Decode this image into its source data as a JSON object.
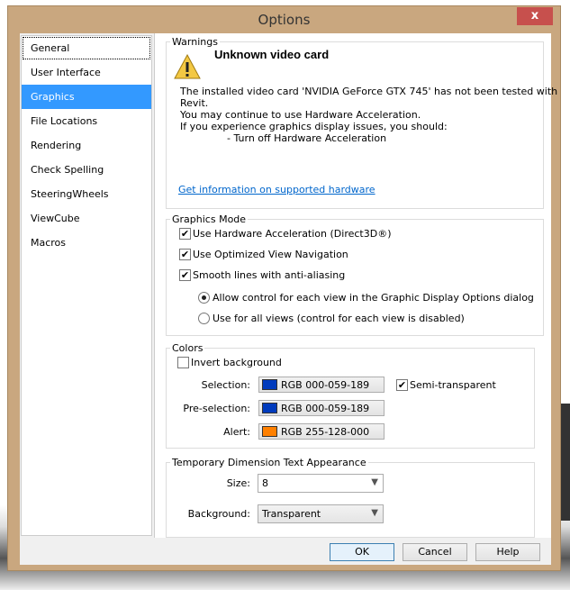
{
  "window": {
    "title": "Options",
    "close_label": "x"
  },
  "sidebar": {
    "items": [
      {
        "label": "General"
      },
      {
        "label": "User Interface"
      },
      {
        "label": "Graphics"
      },
      {
        "label": "File Locations"
      },
      {
        "label": "Rendering"
      },
      {
        "label": "Check Spelling"
      },
      {
        "label": "SteeringWheels"
      },
      {
        "label": "ViewCube"
      },
      {
        "label": "Macros"
      }
    ],
    "selected": "Graphics"
  },
  "warnings": {
    "legend": "Warnings",
    "heading": "Unknown video card",
    "lines": [
      "The installed video card 'NVIDIA GeForce GTX 745' has not been tested with",
      "Revit.",
      "You may continue to use Hardware Acceleration.",
      "If you experience graphics display issues, you should:",
      "- Turn off Hardware Acceleration"
    ],
    "link": "Get information on supported hardware"
  },
  "graphics_mode": {
    "legend": "Graphics Mode",
    "hw_accel": {
      "label": "Use Hardware Acceleration (Direct3D®)",
      "checked": true
    },
    "optimized_nav": {
      "label": "Use Optimized View Navigation",
      "checked": true
    },
    "smooth_lines": {
      "label": "Smooth lines with anti-aliasing",
      "checked": true
    },
    "radio_each": {
      "label": "Allow control for each view in the Graphic Display Options dialog",
      "selected": true
    },
    "radio_all": {
      "label": "Use for all views (control for each view is disabled)",
      "selected": false
    }
  },
  "colors": {
    "legend": "Colors",
    "invert": {
      "label": "Invert background",
      "checked": false
    },
    "selection": {
      "label": "Selection:",
      "value": "RGB 000-059-189",
      "swatch": "#003bbd"
    },
    "semi_transparent": {
      "label": "Semi-transparent",
      "checked": true
    },
    "preselection": {
      "label": "Pre-selection:",
      "value": "RGB 000-059-189",
      "swatch": "#003bbd"
    },
    "alert": {
      "label": "Alert:",
      "value": "RGB 255-128-000",
      "swatch": "#ff8000"
    }
  },
  "temp_dim": {
    "legend": "Temporary Dimension Text Appearance",
    "size_label": "Size:",
    "size_value": "8",
    "background_label": "Background:",
    "background_value": "Transparent"
  },
  "buttons": {
    "ok": "OK",
    "cancel": "Cancel",
    "help": "Help"
  }
}
